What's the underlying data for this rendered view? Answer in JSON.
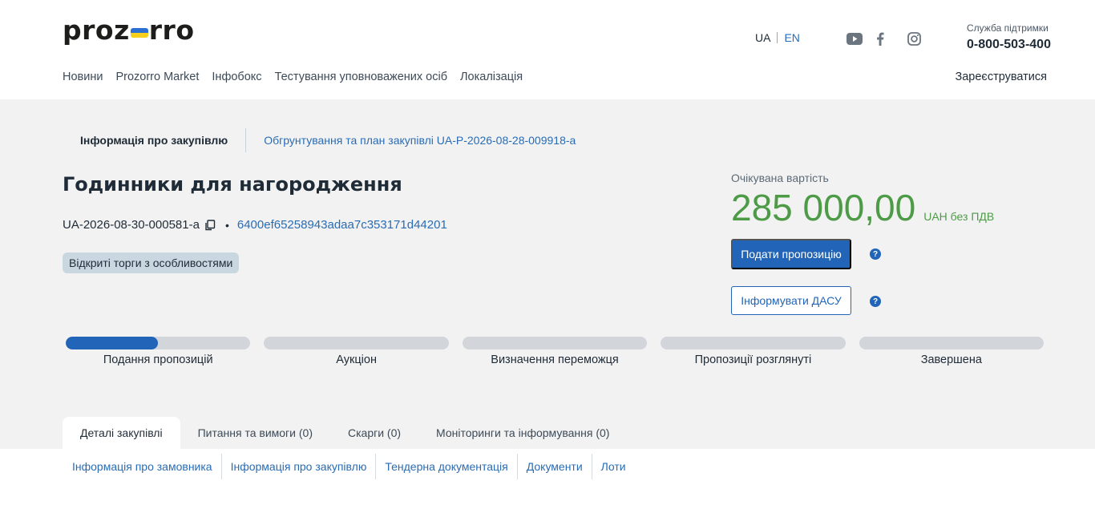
{
  "header": {
    "logo": {
      "left": "proz",
      "right": "rro"
    },
    "lang": {
      "ua": "UA",
      "en": "EN"
    },
    "support": {
      "label": "Служба підтримки",
      "phone": "0-800-503-400"
    },
    "nav": [
      "Новини",
      "Prozorro Market",
      "Інфобокс",
      "Тестування уповноважених осіб",
      "Локалізація"
    ],
    "register": "Зареєструватися",
    "social_icons": [
      "youtube-icon",
      "facebook-icon",
      "instagram-icon"
    ]
  },
  "breadcrumbs": {
    "current": "Інформація про закупівлю",
    "link": "Обгрунтування та план закупівлі UA-P-2026-08-28-009918-a"
  },
  "tender": {
    "title": "Годинники для нагородження",
    "id": "UA-2026-08-30-000581-a",
    "separator": "•",
    "hash": "6400ef65258943adaa7c353171d44201",
    "type_badge": "Відкриті торги з особливостями"
  },
  "value": {
    "label": "Очікувана вартість",
    "amount": "285 000,00",
    "currency": "UAH без ПДВ"
  },
  "actions": {
    "submit": "Подати пропозицію",
    "inform": "Інформувати ДАСУ",
    "help_glyph": "?"
  },
  "stages": [
    {
      "label": "Подання пропозицій",
      "progress": 0.5
    },
    {
      "label": "Аукціон",
      "progress": 0
    },
    {
      "label": "Визначення переможця",
      "progress": 0
    },
    {
      "label": "Пропозиції розглянуті",
      "progress": 0
    },
    {
      "label": "Завершена",
      "progress": 0
    }
  ],
  "tabs": [
    {
      "label": "Деталі закупівлі",
      "active": true
    },
    {
      "label": "Питання та вимоги (0)",
      "active": false
    },
    {
      "label": "Скарги (0)",
      "active": false
    },
    {
      "label": "Моніторинги та інформування (0)",
      "active": false
    }
  ],
  "subnav": [
    "Інформація про замовника",
    "Інформація про закупівлю",
    "Тендерна документація",
    "Документи",
    "Лоти"
  ],
  "colors": {
    "accent": "#2265b8",
    "value_green": "#4d9b47",
    "flag_blue": "#2a6fd1",
    "flag_yellow": "#f5cf1b"
  }
}
